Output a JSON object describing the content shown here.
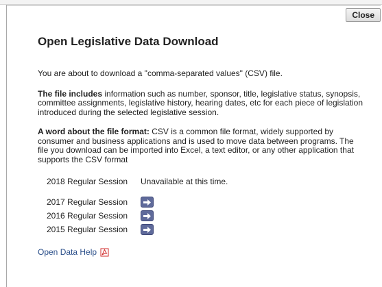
{
  "dialog": {
    "close_label": "Close",
    "title": "Open Legislative Data Download",
    "intro": "You are about to download a \"comma-separated values\" (CSV) file.",
    "includes_heading": "The file includes",
    "includes_text": " information such as number, sponsor, title, legislative status, synopsis, committee assignments, legislative history, hearing dates, etc for each piece of legislation introduced during the selected legislative session.",
    "format_heading": "A word about the file format:",
    "format_text": " CSV is a common file format, widely supported by consumer and business applications and is used to move data between programs. The file you download can be imported into Excel, a text editor, or any other application that supports the CSV format"
  },
  "sessions": [
    {
      "label": "2018 Regular Session",
      "status": "Unavailable at this time."
    },
    {
      "label": "2017 Regular Session",
      "icon": "arrow-right-icon"
    },
    {
      "label": "2016 Regular Session",
      "icon": "arrow-right-icon"
    },
    {
      "label": "2015 Regular Session",
      "icon": "arrow-right-icon"
    }
  ],
  "help": {
    "link_label": "Open Data Help",
    "icon": "pdf-icon"
  },
  "colors": {
    "arrow_button": "#5f6a9a",
    "link": "#2b4f8a",
    "pdf_icon": "#d22b2b"
  }
}
